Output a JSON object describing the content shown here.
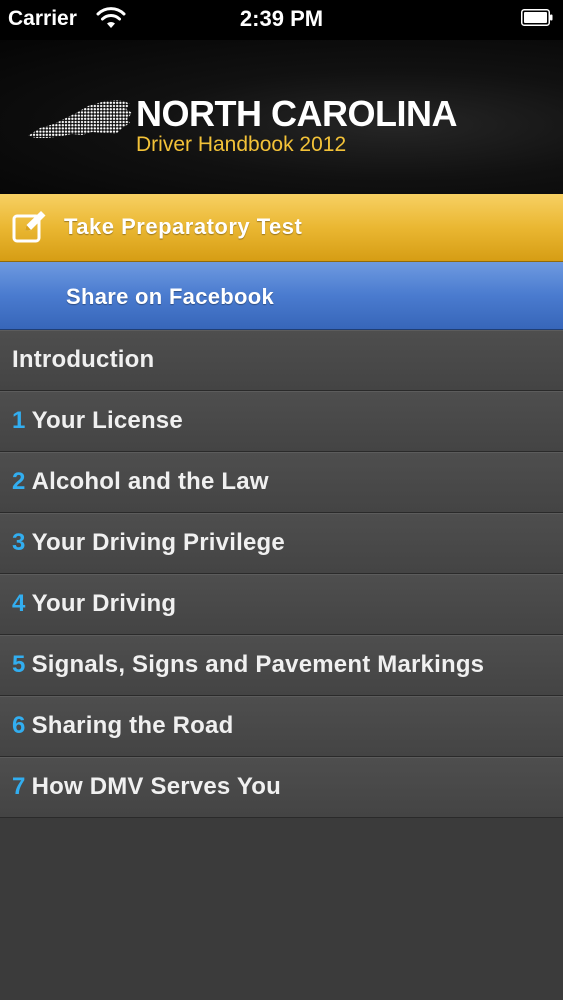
{
  "status_bar": {
    "carrier": "Carrier",
    "time": "2:39 PM"
  },
  "header": {
    "title": "NORTH CAROLINA",
    "subtitle": "Driver Handbook 2012"
  },
  "actions": {
    "test_label": "Take Preparatory Test",
    "facebook_label": "Share on Facebook"
  },
  "chapters": [
    {
      "num": "",
      "title": "Introduction"
    },
    {
      "num": "1",
      "title": "Your License"
    },
    {
      "num": "2",
      "title": "Alcohol and the Law"
    },
    {
      "num": "3",
      "title": "Your Driving Privilege"
    },
    {
      "num": "4",
      "title": "Your Driving"
    },
    {
      "num": "5",
      "title": "Signals, Signs and Pavement Markings"
    },
    {
      "num": "6",
      "title": "Sharing the Road"
    },
    {
      "num": "7",
      "title": "How DMV Serves You"
    }
  ],
  "colors": {
    "accent_gold": "#f3c238",
    "chapter_number": "#32aef0",
    "test_button": "#eab732",
    "facebook_button": "#4a7bcf"
  },
  "icons": {
    "wifi": "wifi-icon",
    "battery": "battery-icon",
    "map": "north-carolina-map-icon",
    "test": "edit-icon"
  }
}
